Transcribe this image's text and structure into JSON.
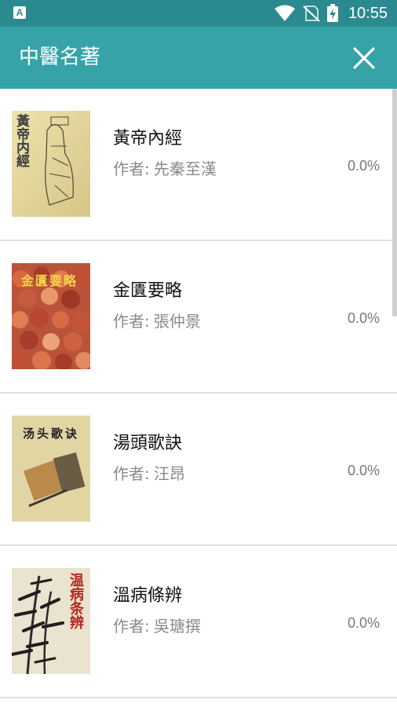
{
  "status_bar": {
    "left_icon": "A",
    "time": "10:55",
    "icons": [
      "wifi-icon",
      "no-sim-icon",
      "battery-charging-icon"
    ]
  },
  "app_bar": {
    "title": "中醫名著",
    "close_icon": "close-icon"
  },
  "books": [
    {
      "title": "黃帝內經",
      "author_label": "作者:",
      "author": "先秦至漢",
      "progress": "0.0%",
      "cover_text": "黃帝内經"
    },
    {
      "title": "金匱要略",
      "author_label": "作者:",
      "author": "張仲景",
      "progress": "0.0%",
      "cover_text": "金匱要略"
    },
    {
      "title": "湯頭歌訣",
      "author_label": "作者:",
      "author": "汪昂",
      "progress": "0.0%",
      "cover_text": "汤头歌诀"
    },
    {
      "title": "溫病條辨",
      "author_label": "作者:",
      "author": "吳瑭撰",
      "progress": "0.0%",
      "cover_text": "温病条辨"
    }
  ],
  "colors": {
    "status_bar": "#2b8a8f",
    "app_bar": "#36a3a8"
  }
}
